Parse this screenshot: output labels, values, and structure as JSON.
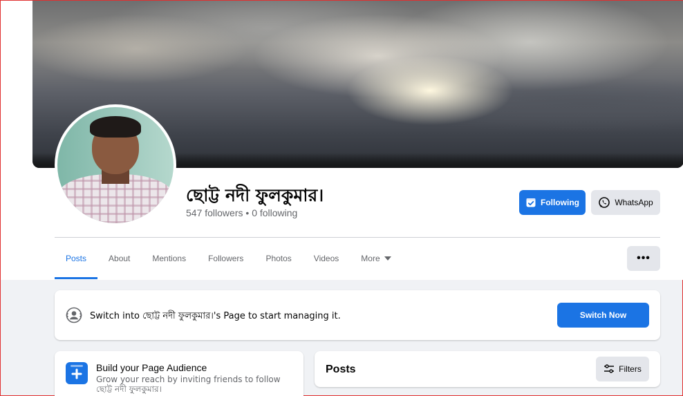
{
  "profile": {
    "name": "ছোট্ট নদী ফুলকুমার।",
    "followers_text": "547 followers",
    "separator": " • ",
    "following_text": "0 following"
  },
  "actions": {
    "following_label": "Following",
    "whatsapp_label": "WhatsApp",
    "more_label": "•••"
  },
  "tabs": [
    {
      "label": "Posts",
      "active": true
    },
    {
      "label": "About"
    },
    {
      "label": "Mentions"
    },
    {
      "label": "Followers"
    },
    {
      "label": "Photos"
    },
    {
      "label": "Videos"
    },
    {
      "label": "More"
    }
  ],
  "switch_banner": {
    "text": "Switch into ছোট্ট নদী ফুলকুমার।'s Page to start managing it.",
    "button_label": "Switch Now"
  },
  "audience_card": {
    "title": "Build your Page Audience",
    "description": "Grow your reach by inviting friends to follow ছোট্ট নদী ফুলকুমার।"
  },
  "posts_section": {
    "title": "Posts",
    "filters_label": "Filters"
  },
  "colors": {
    "accent": "#1b74e4",
    "page_bg": "#f0f2f5",
    "secondary_button": "#e4e6eb"
  }
}
